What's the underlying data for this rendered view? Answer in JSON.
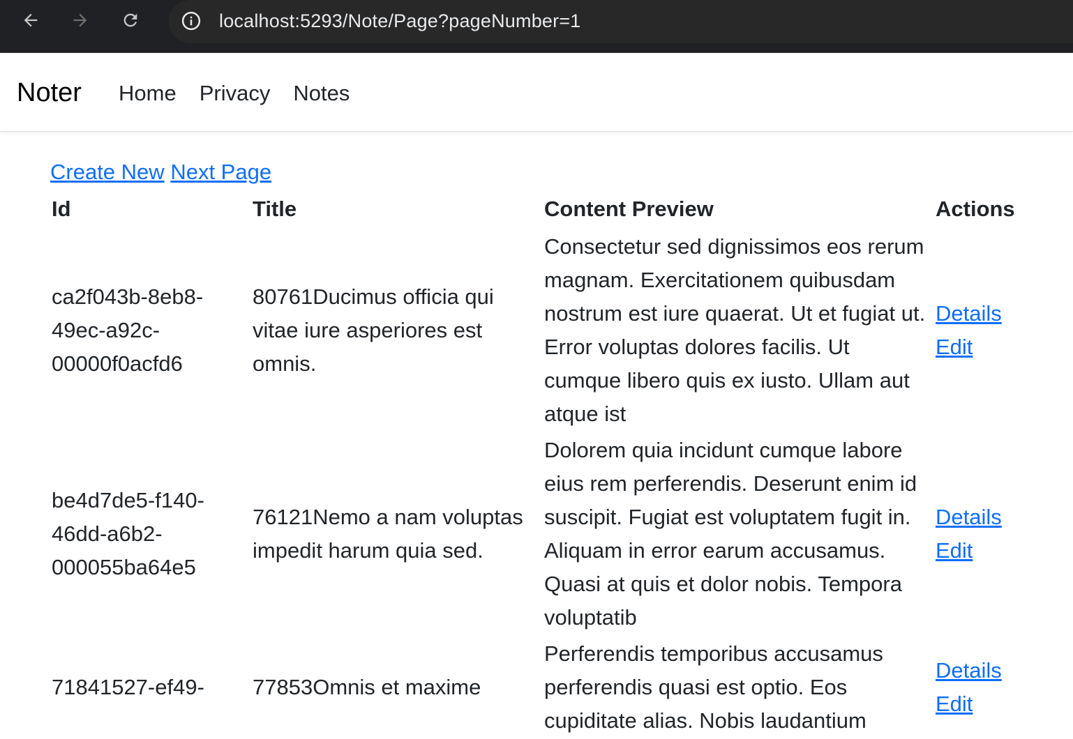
{
  "browser": {
    "url": "localhost:5293/Note/Page?pageNumber=1"
  },
  "navbar": {
    "brand": "Noter",
    "links": [
      "Home",
      "Privacy",
      "Notes"
    ]
  },
  "page": {
    "create_new": "Create New",
    "next_page": "Next Page"
  },
  "table": {
    "headers": [
      "Id",
      "Title",
      "Content Preview",
      "Actions"
    ],
    "rows": [
      {
        "id": "ca2f043b-8eb8-49ec-a92c-00000f0acfd6",
        "title": "80761Ducimus officia qui vitae iure asperiores est omnis.",
        "content": "Consectetur sed dignissimos eos rerum magnam. Exercitationem quibusdam nostrum est iure quaerat. Ut et fugiat ut. Error voluptas dolores facilis. Ut cumque libero quis ex iusto. Ullam aut atque ist",
        "details": "Details",
        "edit": "Edit"
      },
      {
        "id": "be4d7de5-f140-46dd-a6b2-000055ba64e5",
        "title": "76121Nemo a nam voluptas impedit harum quia sed.",
        "content": "Dolorem quia incidunt cumque labore eius rem perferendis. Deserunt enim id suscipit. Fugiat est voluptatem fugit in. Aliquam in error earum accusamus. Quasi at quis et dolor nobis. Tempora voluptatib",
        "details": "Details",
        "edit": "Edit"
      },
      {
        "id": "71841527-ef49-",
        "title": "77853Omnis et maxime",
        "content": "Perferendis temporibus accusamus perferendis quasi est optio. Eos cupiditate alias. Nobis laudantium",
        "details": "Details",
        "edit": "Edit"
      }
    ]
  }
}
